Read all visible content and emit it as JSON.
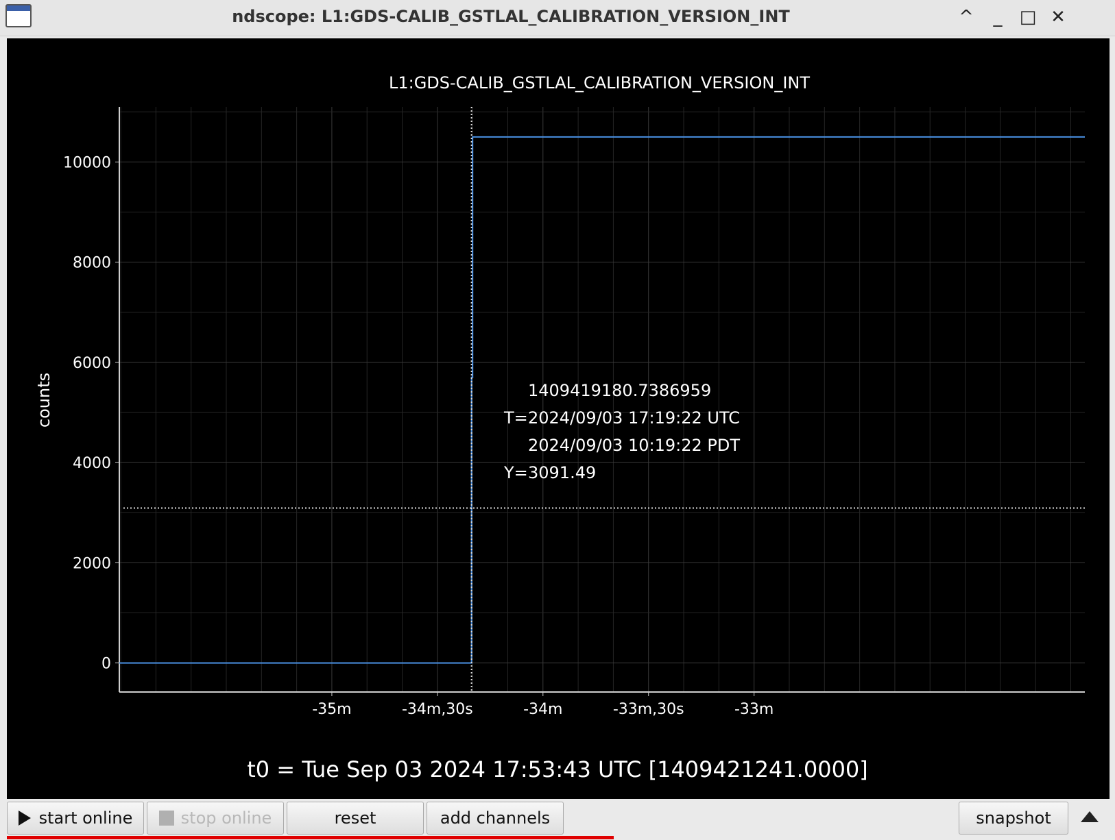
{
  "window": {
    "title": "ndscope: L1:GDS-CALIB_GSTLAL_CALIBRATION_VERSION_INT",
    "controls": {
      "up": "^",
      "minimize": "_",
      "maximize": "□",
      "close": "✕"
    }
  },
  "plot": {
    "t0_label": "t0 = Tue Sep 03 2024 17:53:43 UTC [1409421241.0000]",
    "cursor": {
      "gps": "1409419180.7386959",
      "t_label": "T=",
      "utc": "2024/09/03 17:19:22 UTC",
      "pdt": "2024/09/03 10:19:22 PDT",
      "y_label": "Y=",
      "y_value": "3091.49"
    }
  },
  "chart_data": {
    "type": "line",
    "title": "L1:GDS-CALIB_GSTLAL_CALIBRATION_VERSION_INT",
    "xlabel": "",
    "ylabel": "counts",
    "xlim": [
      -2160.4,
      -1886
    ],
    "ylim": [
      -580,
      11100
    ],
    "x_ticks": [
      {
        "value": -2100,
        "label": "-35m"
      },
      {
        "value": -2070,
        "label": "-34m,30s"
      },
      {
        "value": -2040,
        "label": "-34m"
      },
      {
        "value": -2010,
        "label": "-33m,30s"
      },
      {
        "value": -1980,
        "label": "-33m"
      }
    ],
    "y_ticks": [
      0,
      2000,
      4000,
      6000,
      8000,
      10000
    ],
    "grid": true,
    "series": [
      {
        "color": "#4a90e2",
        "x": [
          -2160.4,
          -2060.3,
          -2060.3,
          -2060,
          -2060,
          -1886
        ],
        "y": [
          0,
          0,
          5700,
          5700,
          10500,
          10500
        ]
      }
    ],
    "cursor_x": -2060.3,
    "cursor_y": 3091.49
  },
  "toolbar": {
    "start_online": "start online",
    "stop_online": "stop online",
    "reset": "reset",
    "add_channels": "add channels",
    "snapshot": "snapshot"
  }
}
